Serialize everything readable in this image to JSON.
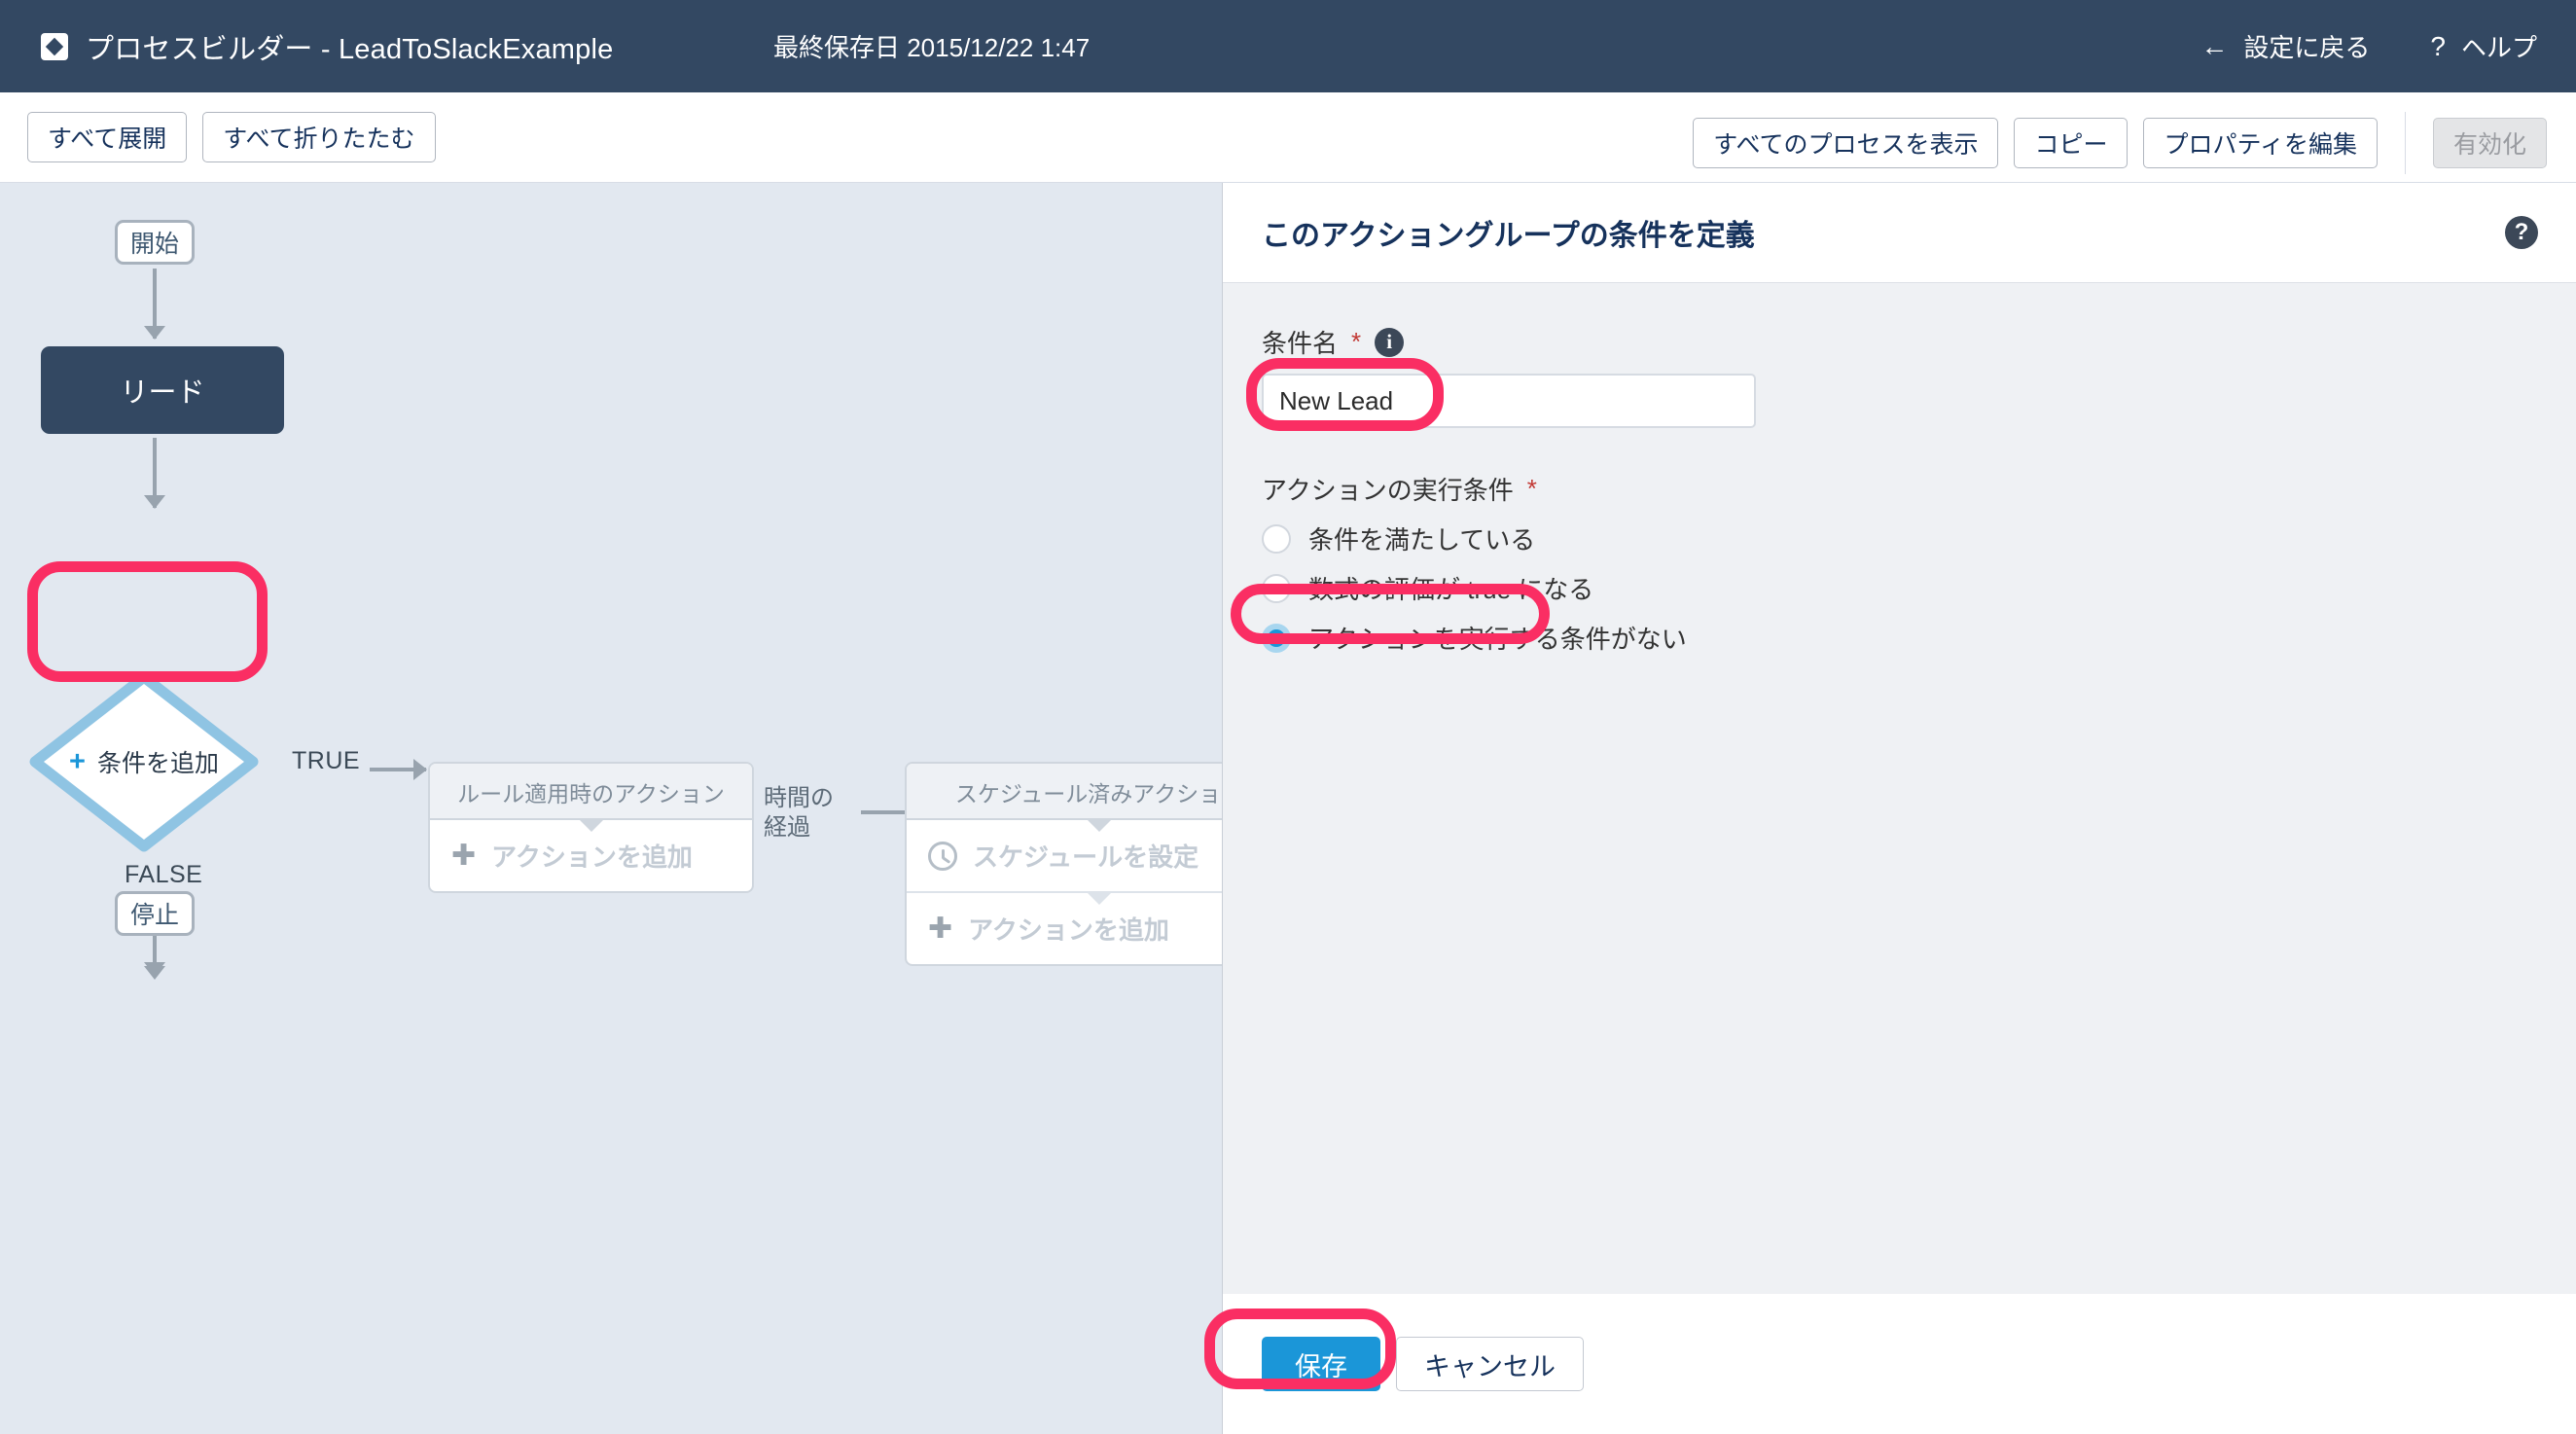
{
  "header": {
    "app_icon": "process-builder-icon",
    "title": "プロセスビルダー - LeadToSlackExample",
    "last_saved": "最終保存日 2015/12/22 1:47",
    "back_arrow": "←",
    "back_label": "設定に戻る",
    "help_glyph": "?",
    "help_label": "ヘルプ"
  },
  "toolbar": {
    "expand_all": "すべて展開",
    "collapse_all": "すべて折りたたむ",
    "view_all_processes": "すべてのプロセスを表示",
    "clone": "コピー",
    "edit_properties": "プロパティを編集",
    "activate": "有効化"
  },
  "canvas": {
    "start_node": "開始",
    "object_node": "リード",
    "criteria_node_plus": "+",
    "criteria_node": "条件を追加",
    "true_label": "TRUE",
    "false_label": "FALSE",
    "stop_node": "停止",
    "time_label": "時間の\n経過",
    "time_label_line1": "時間の",
    "time_label_line2": "経過",
    "immediate_actions": {
      "header": "ルール適用時のアクション",
      "add_plus": "✚",
      "add_label": "アクションを追加"
    },
    "scheduled_actions": {
      "header": "スケジュール済みアクション",
      "set_schedule_icon": "clock-icon",
      "set_schedule_label": "スケジュールを設定",
      "add_plus": "✚",
      "add_label": "アクションを追加"
    }
  },
  "panel": {
    "title": "このアクショングループの条件を定義",
    "help_icon_glyph": "?",
    "criteria_name": {
      "label": "条件名",
      "required_mark": "*",
      "info_glyph": "i",
      "value": "New Lead",
      "placeholder": ""
    },
    "execute_conditions": {
      "label": "アクションの実行条件",
      "required_mark": "*",
      "options": [
        {
          "label": "条件を満たしている",
          "selected": false
        },
        {
          "label": "数式の評価が true になる",
          "selected": false
        },
        {
          "label": "アクションを実行する条件がない",
          "selected": true
        }
      ]
    },
    "footer": {
      "save": "保存",
      "cancel": "キャンセル"
    }
  },
  "colors": {
    "header_bg": "#334862",
    "canvas_bg": "#e2e8f0",
    "object_node_bg": "#334862",
    "accent_blue": "#1b96d8",
    "diamond_stroke": "#8fc4e3",
    "highlight_pink": "#fa2e63",
    "required_red": "#c23934"
  }
}
